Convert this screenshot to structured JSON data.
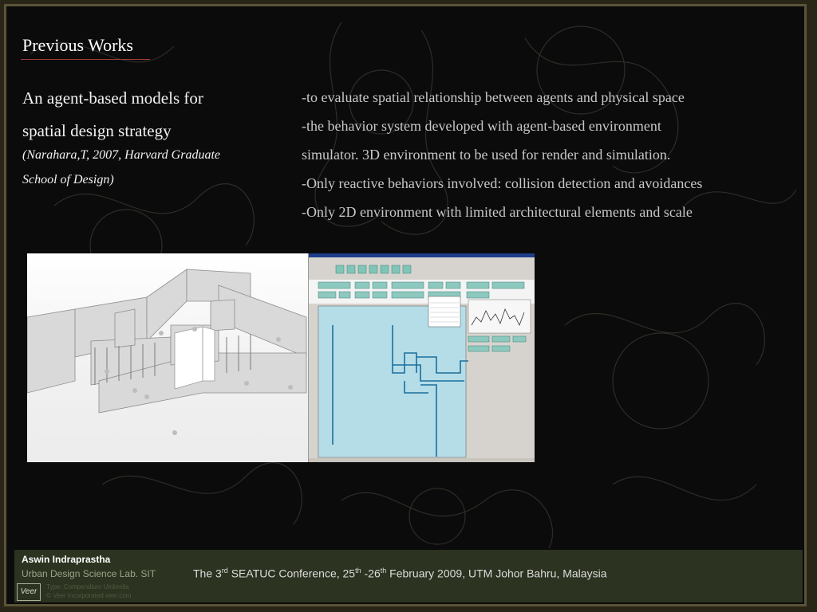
{
  "slide": {
    "title": "Previous Works",
    "heading_line1": "An agent-based models for",
    "heading_line2": "spatial design strategy",
    "citation_line1": "(Narahara,T, 2007, Harvard Graduate",
    "citation_line2": "School of Design)",
    "bullets": [
      "-to evaluate spatial relationship between agents and physical space",
      "-the behavior system developed with agent-based environment",
      "simulator. 3D environment to be used  for render and simulation.",
      "-Only reactive behaviors involved: collision detection and avoidances",
      "-Only 2D environment with limited architectural elements and scale"
    ]
  },
  "footer": {
    "author": "Aswin Indraprastha",
    "affiliation": "Urban Design Science Lab. SIT",
    "conf_prefix": "The 3",
    "conf_sup1": "rd",
    "conf_mid1": " SEATUC Conference, 25",
    "conf_sup2": "th",
    "conf_mid2": " -26",
    "conf_sup3": "th",
    "conf_suffix": "  February 2009, UTM Johor Bahru, Malaysia",
    "logo_text": "Veer",
    "credit_line1": "Type: Compendium Umbrella",
    "credit_line2": "© Veer Incorporated   veer.com"
  },
  "colors": {
    "background": "#0b0b0b",
    "frame": "#5a5438",
    "title_rule": "#a8403a",
    "footer_bg": "#2c3320"
  }
}
